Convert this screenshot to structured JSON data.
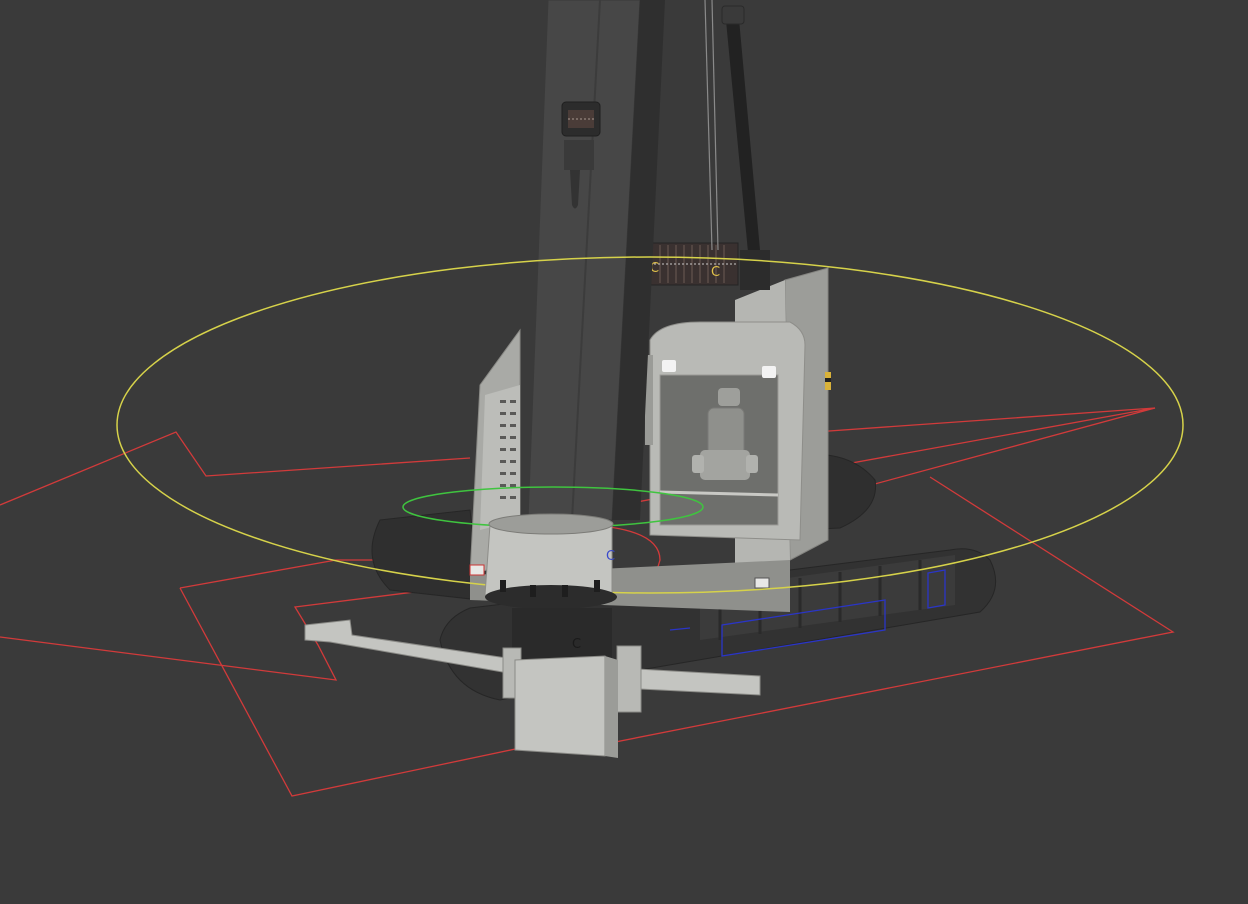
{
  "viewport": {
    "background": "#3a3a3a",
    "model": "crawler-piling-rig",
    "render_mode": "shaded",
    "gizmo_colors": {
      "rotate_ring": "#d6d24a",
      "pivot_ring": "#3fc43f",
      "hull_outline": "#d23a3a",
      "bounding_box": "#2a35c8"
    }
  },
  "labels": {
    "winch_left": "C",
    "winch_right": "C",
    "drum_side": "C",
    "auger_head": "C"
  }
}
